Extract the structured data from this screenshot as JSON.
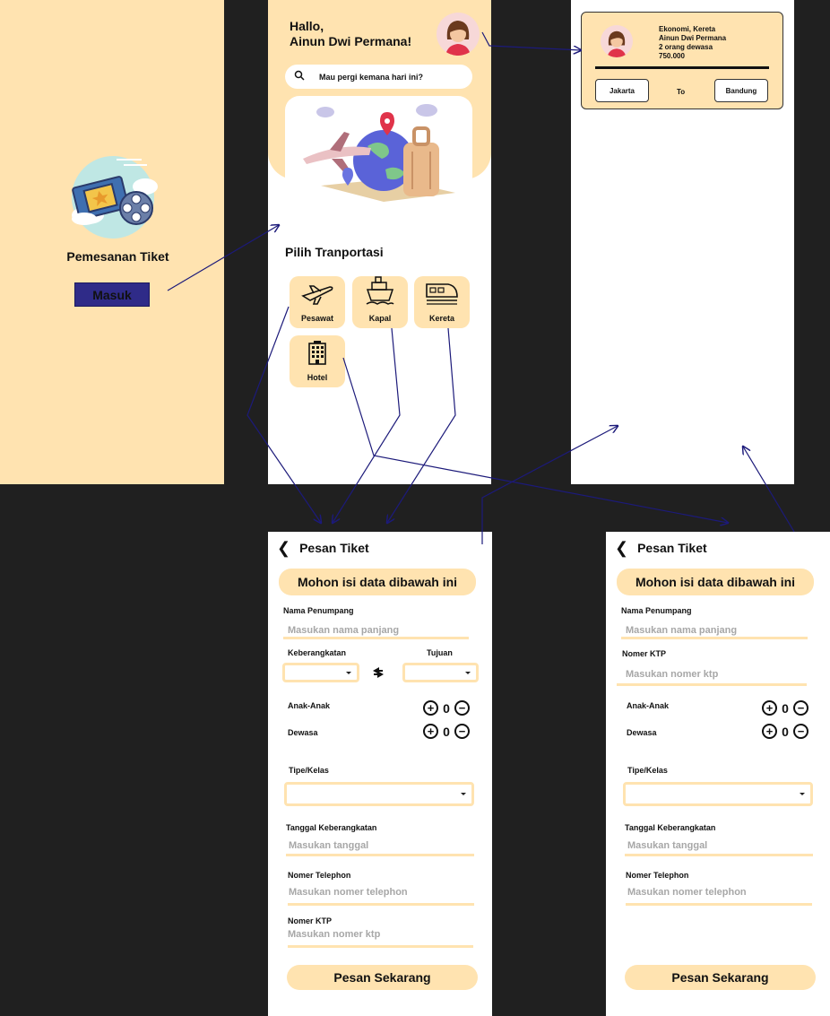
{
  "splash": {
    "title": "Pemesanan Tiket",
    "login_button": "Masuk",
    "logo_icon": "ticket-film-icon"
  },
  "home": {
    "greeting_line1": "Hallo,",
    "greeting_line2": "Ainun Dwi Permana!",
    "search_placeholder": "Mau pergi kemana hari ini?",
    "section_title": "Pilih Tranportasi",
    "transport": [
      {
        "label": "Pesawat",
        "icon": "airplane-icon"
      },
      {
        "label": "Kapal",
        "icon": "ship-icon"
      },
      {
        "label": "Kereta",
        "icon": "train-icon"
      },
      {
        "label": "Hotel",
        "icon": "hotel-icon"
      }
    ]
  },
  "ticket": {
    "line1": "Ekonomi, Kereta",
    "line2": "Ainun Dwi Permana",
    "line3": "2 orang dewasa",
    "line4": "750.000",
    "from": "Jakarta",
    "to_label": "To",
    "to": "Bandung"
  },
  "form_transport": {
    "header": "Pesan Tiket",
    "banner": "Mohon isi data dibawah ini",
    "name_label": "Nama Penumpang",
    "name_placeholder": "Masukan nama panjang",
    "depart_label": "Keberangkatan",
    "dest_label": "Tujuan",
    "children_label": "Anak-Anak",
    "children_count": "0",
    "adults_label": "Dewasa",
    "adults_count": "0",
    "class_label": "Tipe/Kelas",
    "date_label": "Tanggal Keberangkatan",
    "date_placeholder": "Masukan tanggal",
    "phone_label": "Nomer Telephon",
    "phone_placeholder": "Masukan nomer telephon",
    "ktp_label": "Nomer KTP",
    "ktp_placeholder": "Masukan nomer ktp",
    "submit": "Pesan Sekarang"
  },
  "form_hotel": {
    "header": "Pesan Tiket",
    "banner": "Mohon isi data dibawah ini",
    "name_label": "Nama Penumpang",
    "name_placeholder": "Masukan nama panjang",
    "ktp_label": "Nomer KTP",
    "ktp_placeholder": "Masukan nomer ktp",
    "children_label": "Anak-Anak",
    "children_count": "0",
    "adults_label": "Dewasa",
    "adults_count": "0",
    "class_label": "Tipe/Kelas",
    "date_label": "Tanggal Keberangkatan",
    "date_placeholder": "Masukan tanggal",
    "phone_label": "Nomer Telephon",
    "phone_placeholder": "Masukan nomer telephon",
    "submit": "Pesan Sekarang"
  },
  "colors": {
    "background": "#202020",
    "cream": "#ffe3b0",
    "button_navy": "#2f2b88",
    "flow_arrow": "#1c1a7a"
  }
}
